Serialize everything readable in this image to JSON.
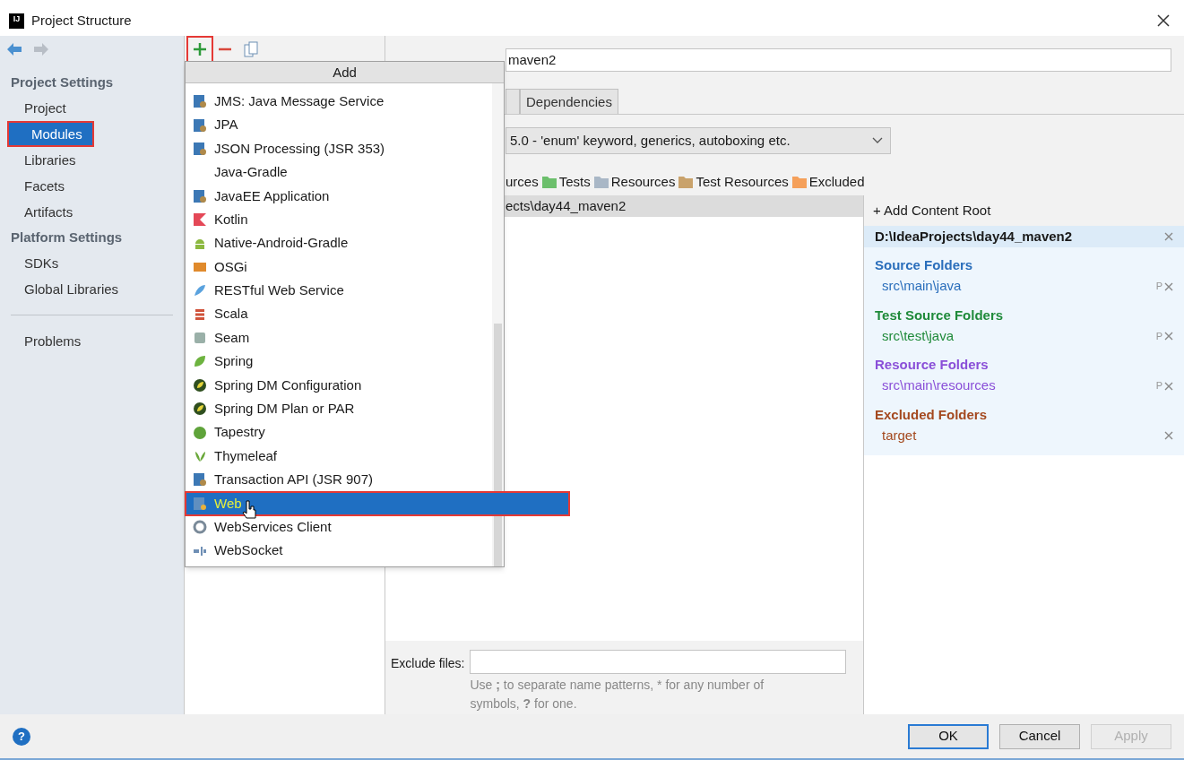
{
  "window": {
    "title": "Project Structure",
    "logo": "IJ"
  },
  "sidebar": {
    "sections": [
      {
        "title": "Project Settings",
        "items": [
          {
            "label": "Project",
            "selected": false
          },
          {
            "label": "Modules",
            "selected": true
          },
          {
            "label": "Libraries",
            "selected": false
          },
          {
            "label": "Facets",
            "selected": false
          },
          {
            "label": "Artifacts",
            "selected": false
          }
        ]
      },
      {
        "title": "Platform Settings",
        "items": [
          {
            "label": "SDKs",
            "selected": false
          },
          {
            "label": "Global Libraries",
            "selected": false
          }
        ]
      }
    ],
    "problems": {
      "label": "Problems",
      "selected": false
    }
  },
  "module": {
    "name": "maven2",
    "tabs": [
      {
        "label": "Dependencies",
        "selected": false
      }
    ],
    "language_level": "5.0 - 'enum' keyword, generics, autoboxing etc.",
    "mark_as": [
      {
        "label": "urces"
      },
      {
        "label": "Tests",
        "color": "#6cbf6c"
      },
      {
        "label": "Resources",
        "color": "#a9b7c6"
      },
      {
        "label": "Test Resources",
        "color": "#c9a26b"
      },
      {
        "label": "Excluded",
        "color": "#f5a05a"
      }
    ],
    "tree_row": {
      "label": "ects\\day44_maven2",
      "selected": true
    },
    "exclude_files": {
      "label": "Exclude files:",
      "hint": "Use **;** to separate name patterns, * for any number of symbols, **?** for one."
    }
  },
  "content_root": {
    "add_label": "+ Add Content Root",
    "path": "D:\\IdeaProjects\\day44_maven2",
    "groups": [
      {
        "title": "Source Folders",
        "color": "#2a6ebb",
        "folders": [
          {
            "path": "src\\main\\java",
            "prefix": "P"
          }
        ]
      },
      {
        "title": "Test Source Folders",
        "color": "#1f8a3a",
        "folders": [
          {
            "path": "src\\test\\java",
            "prefix": "P"
          }
        ]
      },
      {
        "title": "Resource Folders",
        "color": "#8a4fd8",
        "folders": [
          {
            "path": "src\\main\\resources",
            "prefix": "P"
          }
        ]
      },
      {
        "title": "Excluded Folders",
        "color": "#a4491f",
        "folders": [
          {
            "path": "target"
          }
        ]
      }
    ]
  },
  "add_popup": {
    "title": "Add",
    "items": [
      {
        "label": "JMS: Java Message Service",
        "selected": false
      },
      {
        "label": "JPA",
        "selected": false
      },
      {
        "label": "JSON Processing (JSR 353)",
        "selected": false
      },
      {
        "label": "Java-Gradle",
        "selected": false
      },
      {
        "label": "JavaEE Application",
        "selected": false
      },
      {
        "label": "Kotlin",
        "selected": false
      },
      {
        "label": "Native-Android-Gradle",
        "selected": false
      },
      {
        "label": "OSGi",
        "selected": false
      },
      {
        "label": "RESTful Web Service",
        "selected": false
      },
      {
        "label": "Scala",
        "selected": false
      },
      {
        "label": "Seam",
        "selected": false
      },
      {
        "label": "Spring",
        "selected": false
      },
      {
        "label": "Spring DM Configuration",
        "selected": false
      },
      {
        "label": "Spring DM Plan or PAR",
        "selected": false
      },
      {
        "label": "Tapestry",
        "selected": false
      },
      {
        "label": "Thymeleaf",
        "selected": false
      },
      {
        "label": "Transaction API (JSR 907)",
        "selected": false
      },
      {
        "label": "Web",
        "selected": true
      },
      {
        "label": "WebServices Client",
        "selected": false
      },
      {
        "label": "WebSocket",
        "selected": false
      }
    ]
  },
  "buttons": [
    {
      "label": "OK",
      "kind": "default",
      "disabled": false
    },
    {
      "label": "Cancel",
      "kind": "normal",
      "disabled": false
    },
    {
      "label": "Apply",
      "kind": "normal",
      "disabled": true
    }
  ],
  "help": "?"
}
